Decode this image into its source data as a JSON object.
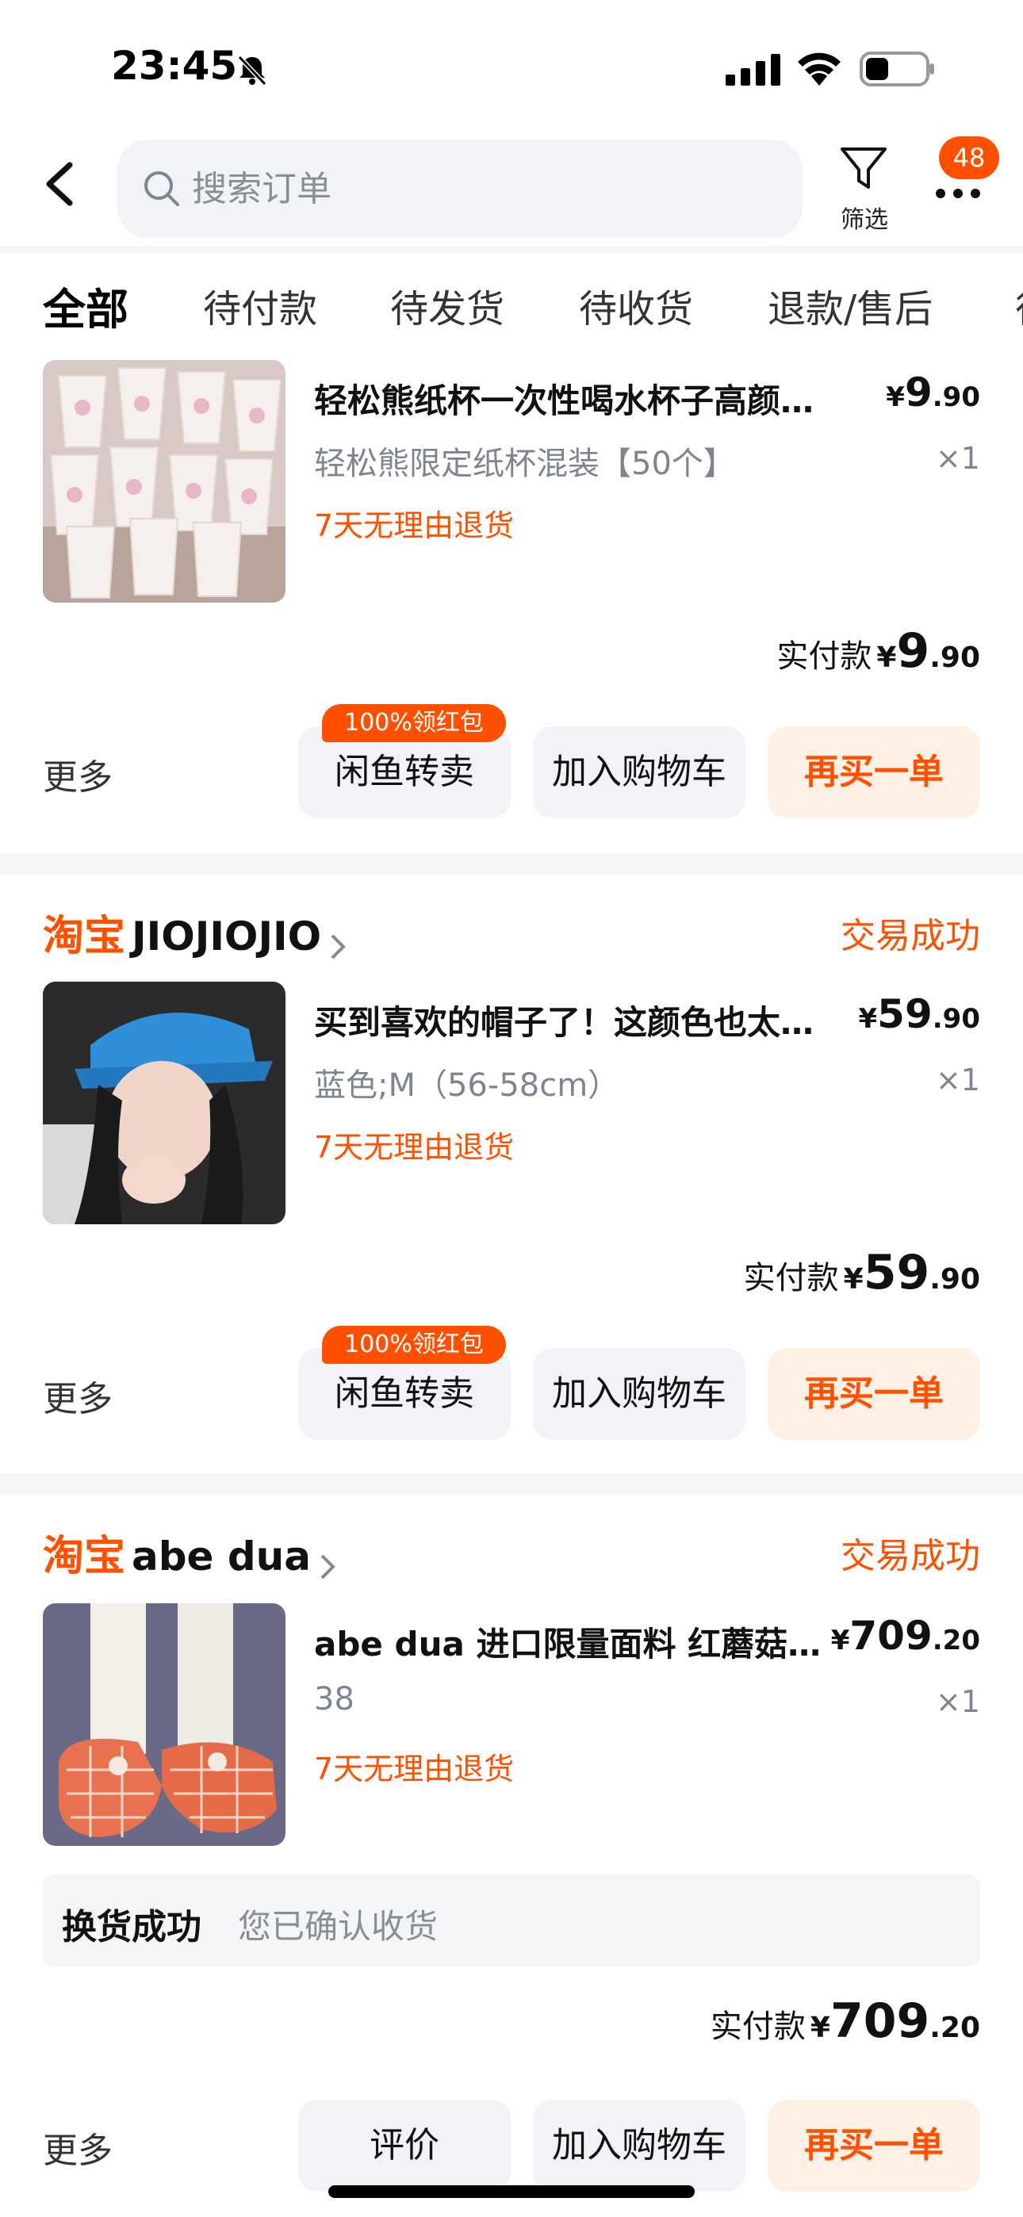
{
  "status_bar": {
    "time": "23:45"
  },
  "header": {
    "search_placeholder": "搜索订单",
    "filter_label": "筛选",
    "more_badge": "48"
  },
  "tabs": [
    "全部",
    "待付款",
    "待发货",
    "待收货",
    "退款/售后"
  ],
  "orders": [
    {
      "product_title": "轻松熊纸杯一次性喝水杯子高颜…",
      "price_yen": "¥",
      "price_int": "9",
      "price_dec": ".90",
      "variant": "轻松熊限定纸杯混装【50个】",
      "qty": "×1",
      "return_tag": "7天无理由退货",
      "paid_label": "实付款",
      "paid_yen": "¥",
      "paid_int": "9",
      "paid_dec": ".90",
      "more": "更多",
      "promo": "100%领红包",
      "btn1": "闲鱼转卖",
      "btn2": "加入购物车",
      "btn3": "再买一单"
    },
    {
      "shop_logo": "淘宝",
      "shop_name": "JIOJIOJIO",
      "status": "交易成功",
      "product_title": "买到喜欢的帽子了！这颜色也太…",
      "price_yen": "¥",
      "price_int": "59",
      "price_dec": ".90",
      "variant": "蓝色;M（56-58cm）",
      "qty": "×1",
      "return_tag": "7天无理由退货",
      "paid_label": "实付款",
      "paid_yen": "¥",
      "paid_int": "59",
      "paid_dec": ".90",
      "more": "更多",
      "promo": "100%领红包",
      "btn1": "闲鱼转卖",
      "btn2": "加入购物车",
      "btn3": "再买一单"
    },
    {
      "shop_logo": "淘宝",
      "shop_name": "abe dua",
      "status": "交易成功",
      "product_title": "abe dua 进口限量面料 红蘑菇…",
      "price_yen": "¥",
      "price_int": "709",
      "price_dec": ".20",
      "variant": "38",
      "qty": "×1",
      "return_tag": "7天无理由退货",
      "exchange_title": "换货成功",
      "exchange_desc": "您已确认收货",
      "paid_label": "实付款",
      "paid_yen": "¥",
      "paid_int": "709",
      "paid_dec": ".20",
      "more": "更多",
      "btn1": "评价",
      "btn2": "加入购物车",
      "btn3": "再买一单"
    }
  ],
  "colors": {
    "accent": "#ff5000",
    "button_bg": "#f1f3f6",
    "primary_button_bg": "#fff0e6",
    "muted_text": "#7e8490"
  }
}
